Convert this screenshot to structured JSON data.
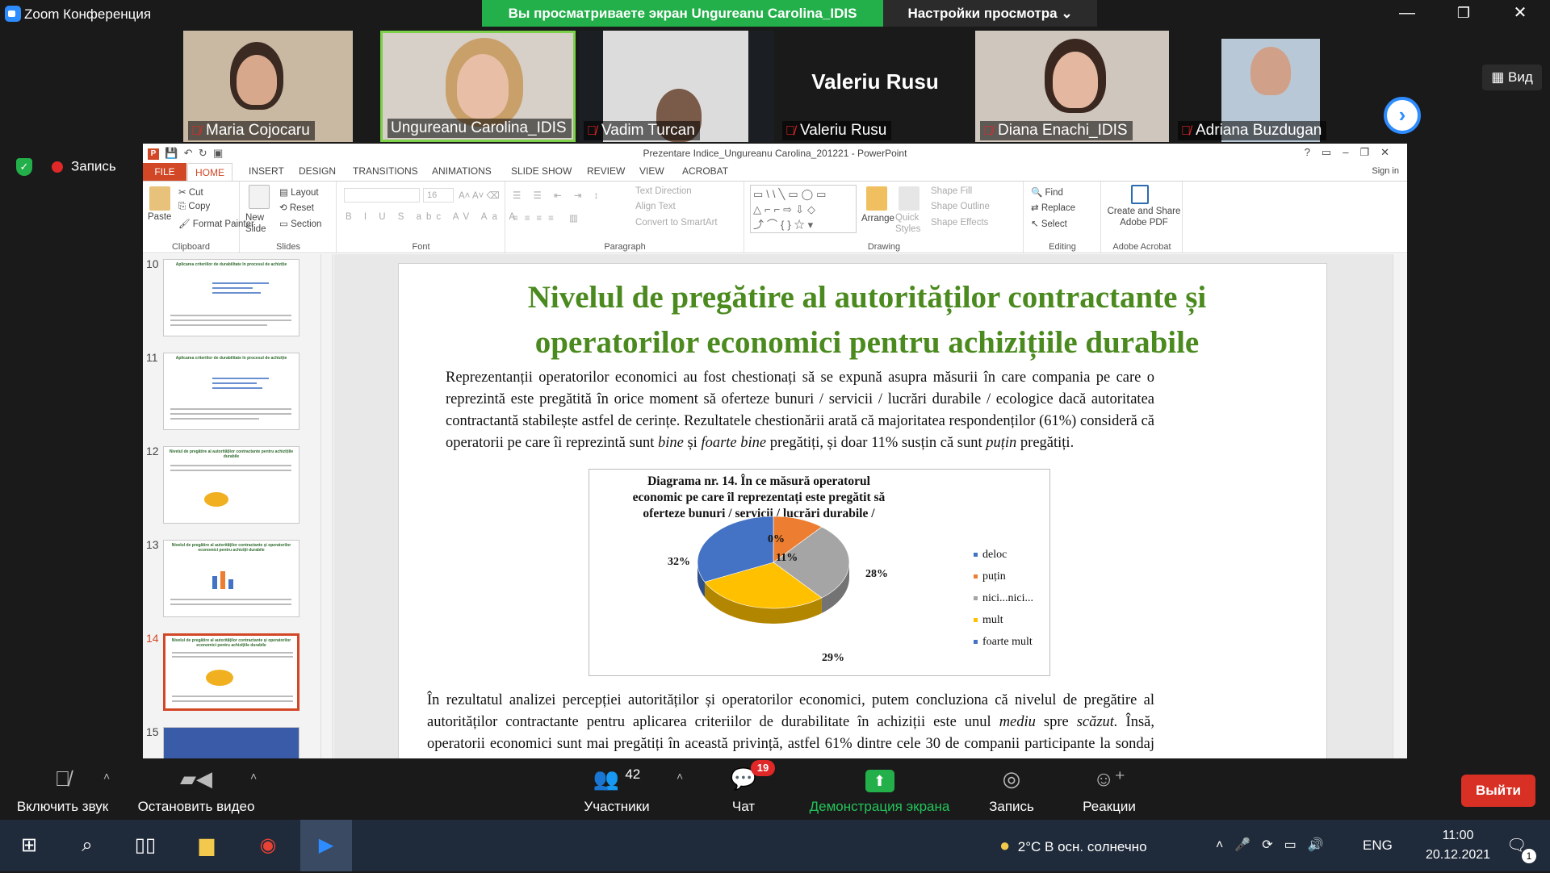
{
  "app": {
    "title": "Zoom Конференция",
    "share_banner": "Вы просматриваете экран Ungureanu Carolina_IDIS",
    "view_options": "Настройки просмотра ⌄"
  },
  "window_controls": {
    "minimize": "—",
    "restore": "❐",
    "close": "✕"
  },
  "participants": [
    {
      "name": "Maria Cojocaru",
      "muted": true
    },
    {
      "name": "Ungureanu Carolina_IDIS",
      "muted": false,
      "active_speaker": true
    },
    {
      "name": "Vadim Turcan",
      "muted": true
    },
    {
      "name": "Valeriu Rusu",
      "muted": true,
      "video_off": true
    },
    {
      "name": "Diana Enachi_IDIS",
      "muted": true
    },
    {
      "name": "Adriana Buzdugan",
      "muted": true
    }
  ],
  "gallery": {
    "view_button": "Вид",
    "record_status": "Запись"
  },
  "powerpoint": {
    "doc_title": "Prezentare Indice_Ungureanu Carolina_201221 - PowerPoint",
    "sign_in": "Sign in",
    "tabs": [
      "FILE",
      "HOME",
      "INSERT",
      "DESIGN",
      "TRANSITIONS",
      "ANIMATIONS",
      "SLIDE SHOW",
      "REVIEW",
      "VIEW",
      "ACROBAT"
    ],
    "ribbon": {
      "clipboard": {
        "paste": "Paste",
        "cut": "Cut",
        "copy": "Copy",
        "format_painter": "Format Painter",
        "label": "Clipboard"
      },
      "slides": {
        "new_slide": "New Slide",
        "layout": "Layout",
        "reset": "Reset",
        "section": "Section",
        "label": "Slides"
      },
      "font": {
        "size": "16",
        "label": "Font"
      },
      "paragraph": {
        "text_direction": "Text Direction",
        "align_text": "Align Text",
        "convert": "Convert to SmartArt",
        "label": "Paragraph"
      },
      "drawing": {
        "arrange": "Arrange",
        "quick_styles": "Quick Styles",
        "shape_fill": "Shape Fill",
        "shape_outline": "Shape Outline",
        "shape_effects": "Shape Effects",
        "label": "Drawing"
      },
      "editing": {
        "find": "Find",
        "replace": "Replace",
        "select": "Select",
        "label": "Editing"
      },
      "acrobat": {
        "create": "Create and Share Adobe PDF",
        "label": "Adobe Acrobat"
      }
    },
    "thumbnails": [
      {
        "num": "10",
        "title": "Aplicarea criteriilor de durabilitate în procesul de achiziție"
      },
      {
        "num": "11",
        "title": "Aplicarea criteriilor de durabilitate în procesul de achiziție"
      },
      {
        "num": "12",
        "title": "Nivelul de pregătire al autorităților contractante pentru achizițiile durabile"
      },
      {
        "num": "13",
        "title": "Nivelul de pregătire al autorităților contractante și operatorilor economici pentru achiziții durabile"
      },
      {
        "num": "14",
        "title": "Nivelul de pregătire al autorităților contractante și operatorilor economici pentru achizițiile durabile",
        "active": true
      },
      {
        "num": "15",
        "title": ""
      }
    ],
    "slide": {
      "title": "Nivelul de pregătire al autorităților contractante și operatorilor economici pentru achizițiile durabile",
      "para1_a": "Reprezentanții operatorilor economici au fost chestionați să se expună asupra măsurii în care compania pe care o reprezintă este pregătită în orice moment să oferteze bunuri / servicii / lucrări durabile / ecologice dacă autoritatea contractantă stabilește astfel de cerințe. Rezultatele chestionării arată că majoritatea respondenților (61%) consideră că operatorii pe care îi reprezintă sunt ",
      "para1_bine": "bine",
      "para1_si": " și ",
      "para1_foarte": "foarte bine",
      "para1_b": " pregătiți, și doar 11% susțin că sunt ",
      "para1_putin": "puțin",
      "para1_c": " pregătiți.",
      "para2_a": "În rezultatul analizei percepției autorităților și operatorilor economici, putem concluziona că nivelul de pregătire al autorităților contractante pentru aplicarea criteriilor de durabilitate în achiziții este unul ",
      "para2_mediu": "mediu",
      "para2_spre": " spre ",
      "para2_scazut": "scăzut.",
      "para2_b": " Însă, operatorii economici sunt mai pregătiți în această privință, astfel 61% dintre cele 30 de companii participante la sondaj sunt bine și foarte bine pregătiți să oferteze"
    }
  },
  "chart_data": {
    "type": "pie",
    "title": "Diagrama nr. 14. În ce măsură operatorul economic pe care îl reprezentați este pregătit să oferteze bunuri / servicii / lucrări durabile / ecologice?",
    "categories": [
      "deloc",
      "puțin",
      "nici...nici...",
      "mult",
      "foarte mult"
    ],
    "values": [
      0,
      11,
      28,
      29,
      32
    ],
    "labels": [
      "0%",
      "11%",
      "28%",
      "29%",
      "32%"
    ],
    "colors": [
      "#4472c4",
      "#ed7d31",
      "#a5a5a5",
      "#ffc000",
      "#4472c4"
    ],
    "legend": "right"
  },
  "controls": {
    "mic": "Включить звук",
    "video": "Остановить видео",
    "participants_count": "42",
    "participants": "Участники",
    "chat": "Чат",
    "chat_badge": "19",
    "share": "Демонстрация экрана",
    "record": "Запись",
    "reactions": "Реакции",
    "exit": "Выйти"
  },
  "taskbar": {
    "weather": "2°C  В осн. солнечно",
    "lang": "ENG",
    "time": "11:00",
    "date": "20.12.2021",
    "notif": "1"
  }
}
